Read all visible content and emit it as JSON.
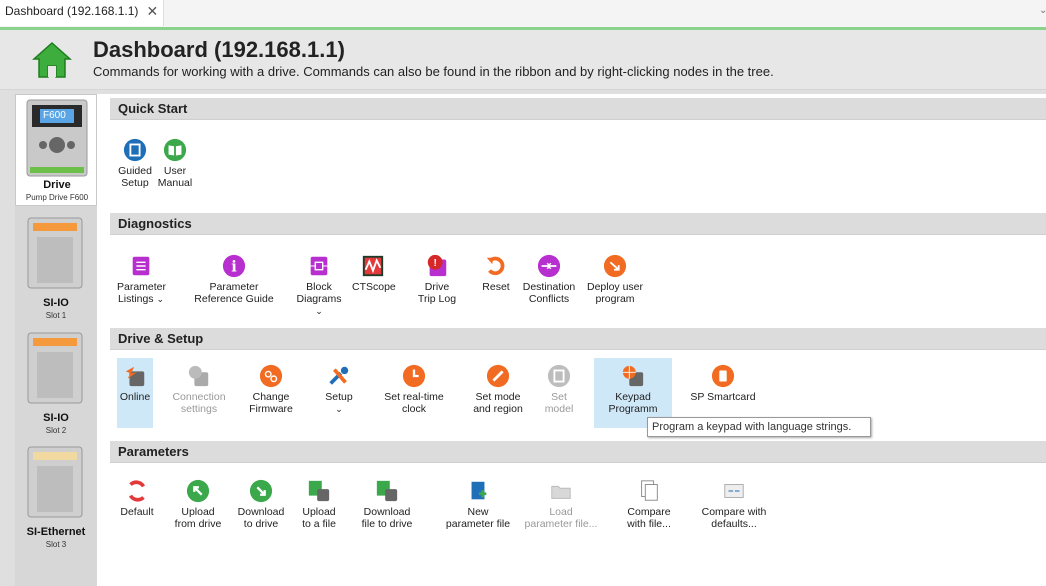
{
  "tab": {
    "label": "Dashboard (192.168.1.1)",
    "close": "✕"
  },
  "header": {
    "title": "Dashboard (192.168.1.1)",
    "subtitle": "Commands for working with a drive. Commands can also be found in the ribbon and by right-clicking nodes in the tree."
  },
  "nodes": [
    {
      "screen": "F600",
      "name": "Drive",
      "sub": "Pump Drive F600"
    },
    {
      "name": "SI-IO",
      "sub": "Slot 1"
    },
    {
      "name": "SI-IO",
      "sub": "Slot 2"
    },
    {
      "name": "SI-Ethernet",
      "sub": "Slot 3"
    }
  ],
  "sections": {
    "quick": "Quick Start",
    "diag": "Diagnostics",
    "drive": "Drive & Setup",
    "params": "Parameters"
  },
  "quick": {
    "guided": [
      "Guided",
      "Setup"
    ],
    "manual": [
      "User",
      "Manual"
    ]
  },
  "diag": {
    "param_listings": [
      "Parameter",
      "Listings"
    ],
    "param_ref": [
      "Parameter",
      "Reference Guide"
    ],
    "block": [
      "Block",
      "Diagrams"
    ],
    "ctscope": "CTScope",
    "trip": [
      "Drive",
      "Trip Log"
    ],
    "reset": "Reset",
    "dest": [
      "Destination",
      "Conflicts"
    ],
    "deploy": [
      "Deploy user",
      "program"
    ]
  },
  "drive": {
    "online": "Online",
    "conn": [
      "Connection",
      "settings"
    ],
    "firmware": [
      "Change",
      "Firmware"
    ],
    "setup": "Setup",
    "clock": [
      "Set real-time",
      "clock"
    ],
    "mode": [
      "Set mode",
      "and region"
    ],
    "model": [
      "Set",
      "model"
    ],
    "keypad": [
      "Keypad",
      "Programm"
    ],
    "sp": "SP Smartcard"
  },
  "params": {
    "default": "Default",
    "upload": [
      "Upload",
      "from drive"
    ],
    "download": [
      "Download",
      "to drive"
    ],
    "upfile": [
      "Upload",
      "to a file"
    ],
    "downfile": [
      "Download",
      "file to drive"
    ],
    "newfile": [
      "New",
      "parameter file"
    ],
    "loadfile": [
      "Load",
      "parameter file..."
    ],
    "compare": [
      "Compare",
      "with file..."
    ],
    "compdef": [
      "Compare with",
      "defaults..."
    ]
  },
  "tooltip": "Program a keypad with language strings.",
  "chevron": "⌄",
  "colors": {
    "accent_green": "#4caf50",
    "blue": "#1e6fb8",
    "orange": "#f26b22",
    "purple": "#b82fcf",
    "red": "#e23a3a"
  }
}
